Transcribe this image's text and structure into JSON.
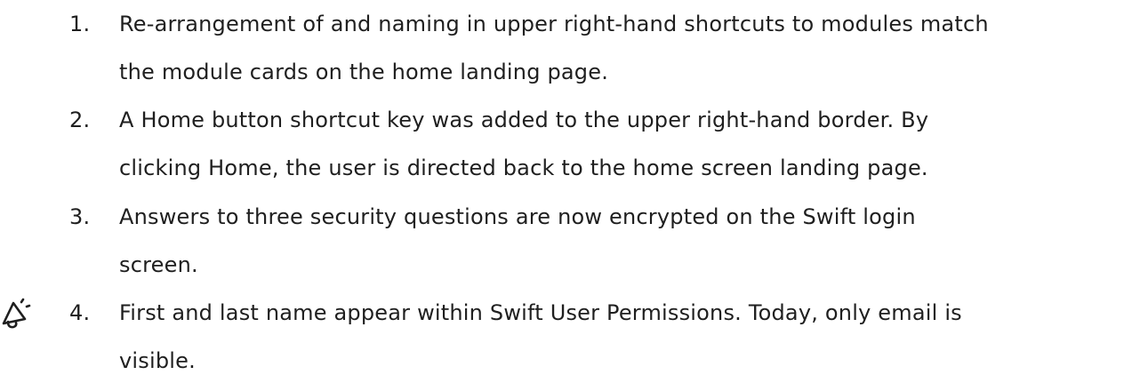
{
  "list": {
    "items": [
      {
        "number": "1.",
        "lines": [
          "Re-arrangement of and naming in upper right-hand shortcuts to modules match",
          "the module cards on the home landing page."
        ]
      },
      {
        "number": "2.",
        "lines": [
          "A Home button shortcut key was added to the upper right-hand border. By",
          "clicking Home, the user is directed back to the home screen landing page."
        ]
      },
      {
        "number": "3.",
        "lines": [
          "Answers to three security questions are now encrypted on the Swift login",
          "screen."
        ]
      },
      {
        "number": "4.",
        "lines": [
          "First and last name appear within Swift User Permissions. Today, only email is",
          "visible."
        ]
      }
    ]
  },
  "icons": {
    "item4_marker": "megaphone-icon"
  }
}
